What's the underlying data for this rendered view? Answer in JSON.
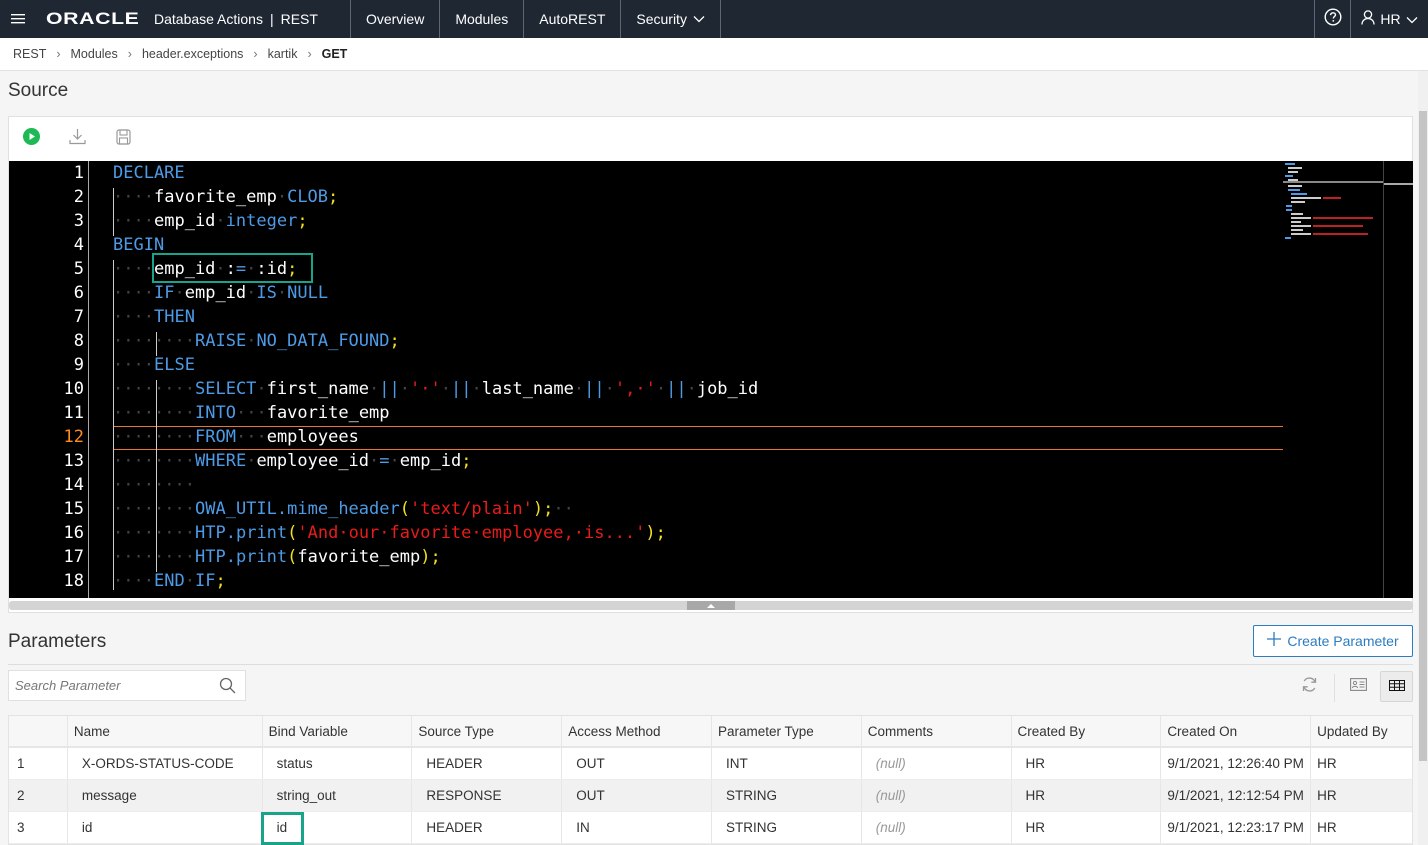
{
  "topbar": {
    "menu_icon": "hamburger-icon",
    "logo": "ORACLE",
    "product": "Database Actions",
    "separator": "|",
    "section": "REST",
    "nav": [
      {
        "label": "Overview"
      },
      {
        "label": "Modules"
      },
      {
        "label": "AutoREST"
      },
      {
        "label": "Security",
        "has_dropdown": true
      }
    ],
    "help_icon": "help-circle-icon",
    "user": {
      "icon": "user-icon",
      "name": "HR"
    }
  },
  "breadcrumb": [
    "REST",
    "Modules",
    "header.exceptions",
    "kartik",
    "GET"
  ],
  "source": {
    "title": "Source",
    "toolbar": {
      "run_icon": "play-circle-icon",
      "download_icon": "download-icon",
      "save_icon": "save-icon"
    },
    "active_line": 12,
    "highlighted_line": 5,
    "lines": [
      {
        "n": "1",
        "code": "DECLARE"
      },
      {
        "n": "2",
        "code": "    favorite_emp CLOB;"
      },
      {
        "n": "3",
        "code": "    emp_id integer;"
      },
      {
        "n": "4",
        "code": "BEGIN"
      },
      {
        "n": "5",
        "code": "    emp_id := :id;"
      },
      {
        "n": "6",
        "code": "    IF emp_id IS NULL"
      },
      {
        "n": "7",
        "code": "    THEN"
      },
      {
        "n": "8",
        "code": "        RAISE NO_DATA_FOUND;"
      },
      {
        "n": "9",
        "code": "    ELSE"
      },
      {
        "n": "10",
        "code": "        SELECT first_name || ' ' || last_name || ', ' || job_id"
      },
      {
        "n": "11",
        "code": "        INTO   favorite_emp"
      },
      {
        "n": "12",
        "code": "        FROM   employees"
      },
      {
        "n": "13",
        "code": "        WHERE employee_id = emp_id;"
      },
      {
        "n": "14",
        "code": "        "
      },
      {
        "n": "15",
        "code": "        OWA_UTIL.mime_header('text/plain');  "
      },
      {
        "n": "16",
        "code": "        HTP.print('And our favorite employee, is...');"
      },
      {
        "n": "17",
        "code": "        HTP.print(favorite_emp);"
      },
      {
        "n": "18",
        "code": "    END IF;"
      }
    ]
  },
  "parameters": {
    "title": "Parameters",
    "create_label": "Create Parameter",
    "search_placeholder": "Search Parameter",
    "refresh_icon": "refresh-icon",
    "card_view_icon": "card-view-icon",
    "table_view_icon": "table-view-icon",
    "columns": [
      "",
      "Name",
      "Bind Variable",
      "Source Type",
      "Access Method",
      "Parameter Type",
      "Comments",
      "Created By",
      "Created On",
      "Updated By"
    ],
    "rows": [
      [
        "1",
        "X-ORDS-STATUS-CODE",
        "status",
        "HEADER",
        "OUT",
        "INT",
        "(null)",
        "HR",
        "9/1/2021, 12:26:40 PM",
        "HR"
      ],
      [
        "2",
        "message",
        "string_out",
        "RESPONSE",
        "OUT",
        "STRING",
        "(null)",
        "HR",
        "9/1/2021, 12:12:54 PM",
        "HR"
      ],
      [
        "3",
        "id",
        "id",
        "HEADER",
        "IN",
        "STRING",
        "(null)",
        "HR",
        "9/1/2021, 12:23:17 PM",
        "HR"
      ]
    ]
  },
  "colors": {
    "topbar_bg": "#1f2733",
    "accent_blue": "#2c7cbf",
    "highlight_green": "#1aa38b",
    "active_line_orange": "#e8772e",
    "run_green": "#1db954"
  }
}
